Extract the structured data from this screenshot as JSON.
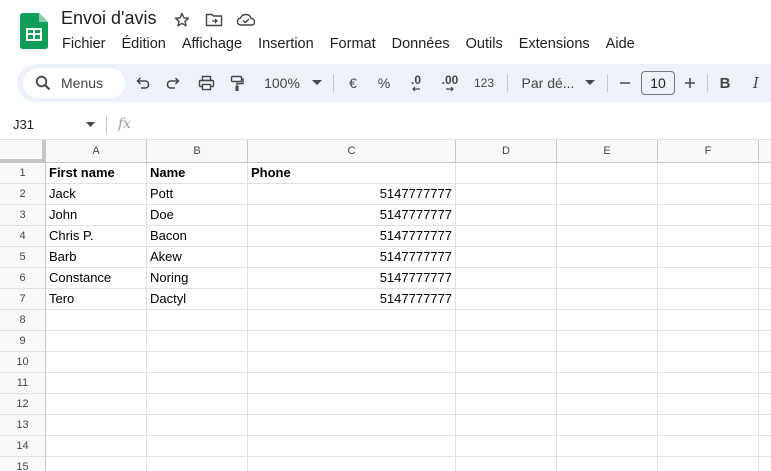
{
  "document": {
    "title": "Envoi d'avis"
  },
  "menu": [
    "Fichier",
    "Édition",
    "Affichage",
    "Insertion",
    "Format",
    "Données",
    "Outils",
    "Extensions",
    "Aide"
  ],
  "toolbar": {
    "search_label": "Menus",
    "zoom": "100%",
    "currency": "€",
    "percent": "%",
    "decrease_decimal": ".0",
    "increase_decimal": ".00",
    "number_format": "123",
    "font_family": "Par dé...",
    "font_size": "10",
    "bold": "B",
    "italic": "I"
  },
  "formula_bar": {
    "cell_ref": "J31",
    "fx": "fx",
    "value": ""
  },
  "columns": [
    "A",
    "B",
    "C",
    "D",
    "E",
    "F"
  ],
  "rows": [
    "1",
    "2",
    "3",
    "4",
    "5",
    "6",
    "7",
    "8",
    "9",
    "10",
    "11",
    "12",
    "13",
    "14",
    "15"
  ],
  "table": {
    "headers": [
      "First name",
      "Name",
      "Phone"
    ],
    "data": [
      [
        "Jack",
        "Pott",
        "5147777777"
      ],
      [
        "John",
        "Doe",
        "5147777777"
      ],
      [
        "Chris P.",
        "Bacon",
        "5147777777"
      ],
      [
        "Barb",
        "Akew",
        "5147777777"
      ],
      [
        "Constance",
        "Noring",
        "5147777777"
      ],
      [
        "Tero",
        "Dactyl",
        "5147777777"
      ]
    ]
  },
  "colors": {
    "accent": "#0f9d58",
    "toolbar_bg": "#edf2fa",
    "grid_line": "#e1e1e1"
  }
}
